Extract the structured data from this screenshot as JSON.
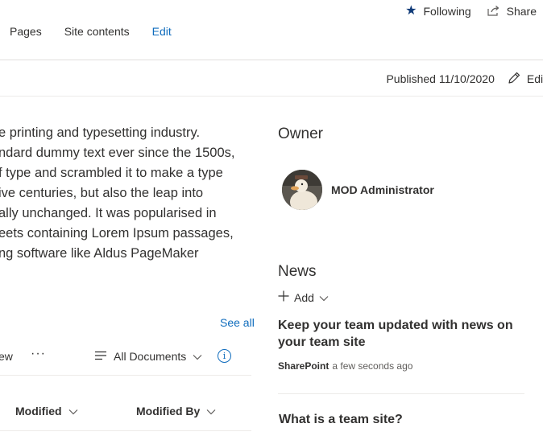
{
  "top_actions": {
    "following_label": "Following",
    "share_label": "Share"
  },
  "nav": {
    "items": [
      "Pages",
      "Site contents",
      "Edit"
    ]
  },
  "publish_bar": {
    "status": "Published 11/10/2020",
    "edit_label": "Edit"
  },
  "body_text": {
    "lines": [
      "e printing and typesetting industry.",
      "ndard dummy text ever since the 1500s,",
      "f type and scrambled it to make a type",
      "ive centuries, but also the leap into",
      "ally unchanged. It was popularised in",
      "eets containing Lorem Ipsum passages,",
      "ng software like Aldus PageMaker"
    ]
  },
  "documents": {
    "see_all": "See all",
    "view_fragment": "ew",
    "more": "···",
    "view_name": "All Documents",
    "columns": [
      "Modified",
      "Modified By"
    ]
  },
  "owner": {
    "title": "Owner",
    "name": "MOD Administrator"
  },
  "news": {
    "title": "News",
    "add_label": "Add",
    "headline": "Keep your team updated with news on your team site",
    "source": "SharePoint",
    "time": "a few seconds ago",
    "next_headline": "What is a team site?"
  },
  "colors": {
    "accent": "#0f6cbd",
    "following_star": "#0f3a78",
    "text": "#323130",
    "divider": "#e1dfdd"
  }
}
